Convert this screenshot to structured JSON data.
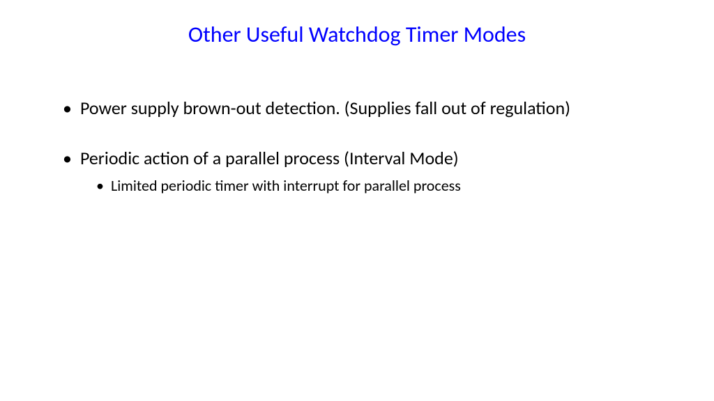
{
  "title": "Other Useful Watchdog Timer Modes",
  "bullets": [
    {
      "level": 1,
      "text": "Power supply brown-out detection. (Supplies fall out of regulation)"
    },
    {
      "level": 1,
      "text": "Periodic action of a parallel process (Interval Mode)"
    },
    {
      "level": 2,
      "text": "Limited periodic timer with interrupt for parallel process"
    }
  ]
}
